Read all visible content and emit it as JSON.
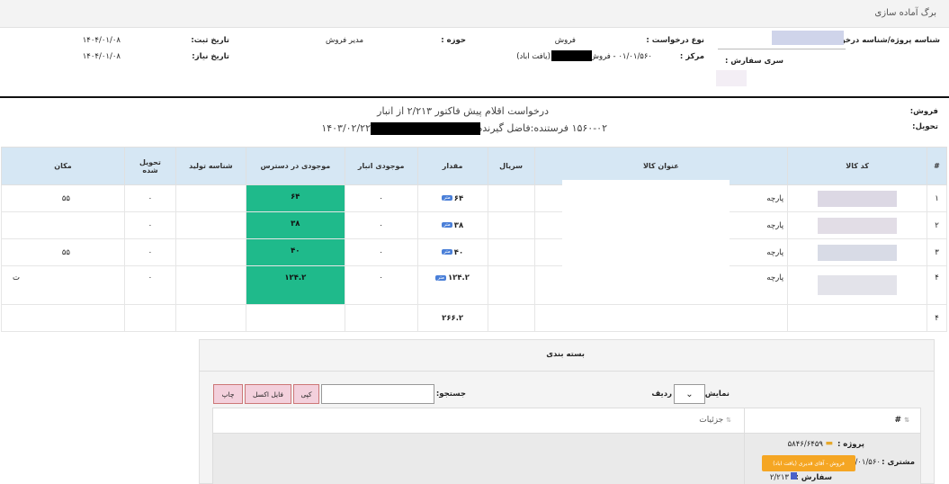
{
  "page_title": "برگ آماده سازی",
  "header": {
    "project_id_label": "شناسه پروژه/شناسه درخواست :",
    "request_type_label": "نوع درخواست :",
    "request_type_value": "فروش",
    "domain_label": "حوزه :",
    "domain_value": "مدیر فروش",
    "reg_date_label": "تاریخ ثبت:",
    "reg_date_value": "۱۴۰۴/۰۱/۰۸",
    "order_series_label": "سری سفارش :",
    "center_label": "مرکز :",
    "center_value": "۰۱/۰۱/۵۶۰ - فروش -",
    "center_value2": "(یافت اباد)",
    "need_date_label": "تاریخ نیاز:",
    "need_date_value": "۱۴۰۴/۰۱/۰۸"
  },
  "info": {
    "sale_label": "فروش:",
    "delivery_label": "تحویل:",
    "request_text": "درخواست اقلام پیش فاکتور ۲/۲۱۳ از انبار",
    "sender_text": "۱۵۶۰-۰۲ فرستنده:فاضل گیرنده",
    "sender_date": "۱۴۰۳/۰۲/۲۲"
  },
  "table": {
    "headers": [
      "#",
      "کد کالا",
      "عنوان کالا",
      "سریال",
      "مقدار",
      "موجودی انبار",
      "موجودی در دسترس",
      "شناسه تولید",
      "تحویل شده",
      "مکان"
    ],
    "unit_label": "متر",
    "rows": [
      {
        "num": "۱",
        "title": "پارچه",
        "qty": "۶۴",
        "stock": "۰",
        "available": "۶۴",
        "delivered": "۰",
        "location": "۵۵"
      },
      {
        "num": "۲",
        "title": "پارچه",
        "qty": "۳۸",
        "stock": "۰",
        "available": "۳۸",
        "delivered": "۰",
        "location": ""
      },
      {
        "num": "۳",
        "title": "پارچه",
        "qty": "۴۰",
        "stock": "۰",
        "available": "۴۰",
        "delivered": "۰",
        "location": "۵۵"
      },
      {
        "num": "۴",
        "title": "پارچه",
        "qty": "۱۲۴.۲",
        "stock": "۰",
        "available": "۱۲۴.۲",
        "delivered": "۰",
        "location": "ت"
      }
    ],
    "total_row_num": "۴",
    "total_qty": "۲۶۶.۲"
  },
  "packaging": {
    "title": "بسته بندی",
    "show_label": "نمایش",
    "rows_label": "ردیف",
    "search_label": "جستجو:",
    "btn_copy": "کپی",
    "btn_excel": "فایل اکسل",
    "btn_print": "چاپ",
    "col_num": "#",
    "col_details": "جزئیات",
    "project_label": "پروژه :",
    "project_value": "۵۸۴۶/۶۴۵۹",
    "customer_label": "مشتری :",
    "customer_value": "۰۱/۰۱/۵۶۰",
    "customer_badge": "فروش - آقای قدیری (یافت اباد)",
    "order_label": "سفارش :",
    "order_value": "۲/۲۱۳"
  },
  "colors": {
    "header_bg": "#d6e7f4",
    "available_green": "#1fba8b",
    "button_pink": "#f3d0dc",
    "badge_orange": "#f5a623"
  }
}
